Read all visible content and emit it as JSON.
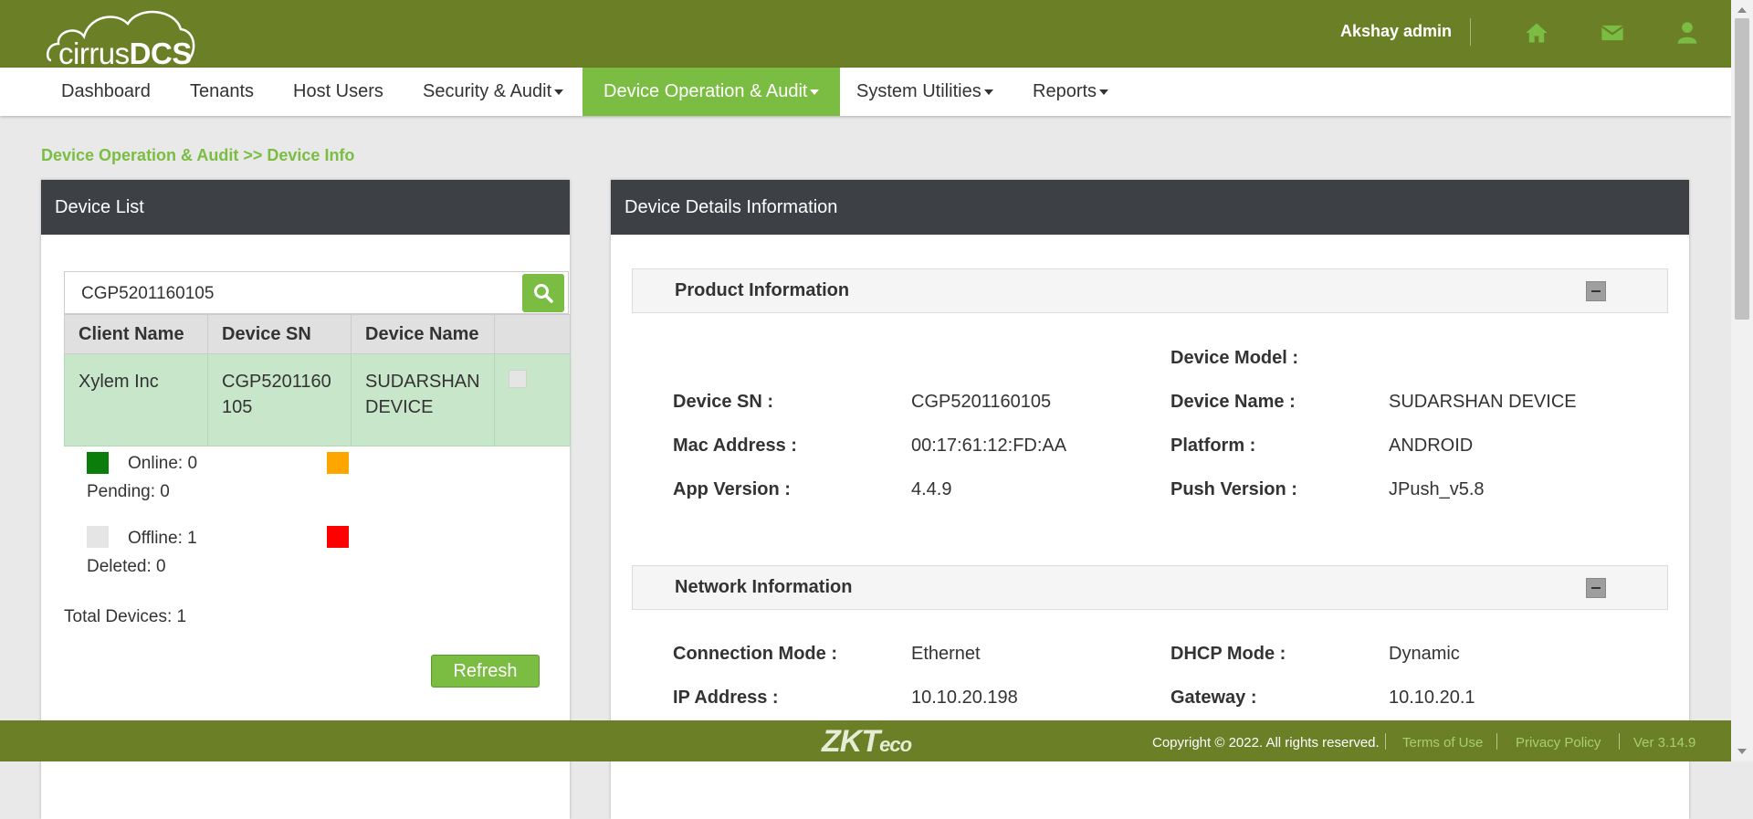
{
  "header": {
    "logo": {
      "part1": "cirrus",
      "part2": "DCS"
    },
    "user_name": "Akshay admin",
    "icons": [
      "home-icon",
      "envelope-icon",
      "user-icon"
    ]
  },
  "nav": {
    "items": [
      {
        "label": "Dashboard"
      },
      {
        "label": "Tenants"
      },
      {
        "label": "Host Users"
      },
      {
        "label": "Security & Audit"
      },
      {
        "label": "Device Operation & Audit"
      },
      {
        "label": "System Utilities"
      },
      {
        "label": "Reports"
      }
    ],
    "active_index": 4
  },
  "breadcrumb": "Device Operation & Audit >> Device Info",
  "device_list": {
    "title": "Device List",
    "search_value": "CGP5201160105",
    "columns": [
      "Client Name",
      "Device SN",
      "Device Name"
    ],
    "rows": [
      {
        "client": "Xylem Inc",
        "sn_line1": "CGP5201160",
        "sn_line2": "105",
        "name_line1": "SUDARSHAN",
        "name_line2": "DEVICE"
      }
    ],
    "legend": {
      "online": "Online: 0",
      "pending": "Pending: 0",
      "offline": "Offline: 1",
      "deleted": "Deleted: 0"
    },
    "legend_colors": {
      "online": "#0a7d0a",
      "pending": "#ffa500",
      "offline": "#e5e5e5",
      "deleted": "#ff0000"
    },
    "total": "Total Devices: 1",
    "refresh_label": "Refresh"
  },
  "details": {
    "title": "Device Details Information",
    "product": {
      "title": "Product Information",
      "model_label": "Device Model :",
      "model_value": "",
      "fields": [
        {
          "label": "Device SN :",
          "value": "CGP5201160105"
        },
        {
          "label": "Device Name :",
          "value": "SUDARSHAN DEVICE"
        },
        {
          "label": "Mac Address :",
          "value": "00:17:61:12:FD:AA"
        },
        {
          "label": "Platform :",
          "value": "ANDROID"
        },
        {
          "label": "App Version :",
          "value": "4.4.9"
        },
        {
          "label": "Push Version :",
          "value": "JPush_v5.8"
        }
      ]
    },
    "network": {
      "title": "Network Information",
      "fields": [
        {
          "label": "Connection Mode :",
          "value": "Ethernet"
        },
        {
          "label": "DHCP Mode :",
          "value": "Dynamic"
        },
        {
          "label": "IP Address :",
          "value": "10.10.20.198"
        },
        {
          "label": "Gateway :",
          "value": "10.10.20.1"
        }
      ]
    }
  },
  "footer": {
    "logo_main": "ZKT",
    "logo_sub": "eco",
    "copyright": "Copyright © 2022. All rights reserved.",
    "terms": "Terms of Use",
    "privacy": "Privacy Policy",
    "version": "Ver 3.14.9"
  },
  "colors": {
    "header_bg": "#6b7f27",
    "accent": "#7bbd42",
    "panel_head": "#3d4146"
  }
}
